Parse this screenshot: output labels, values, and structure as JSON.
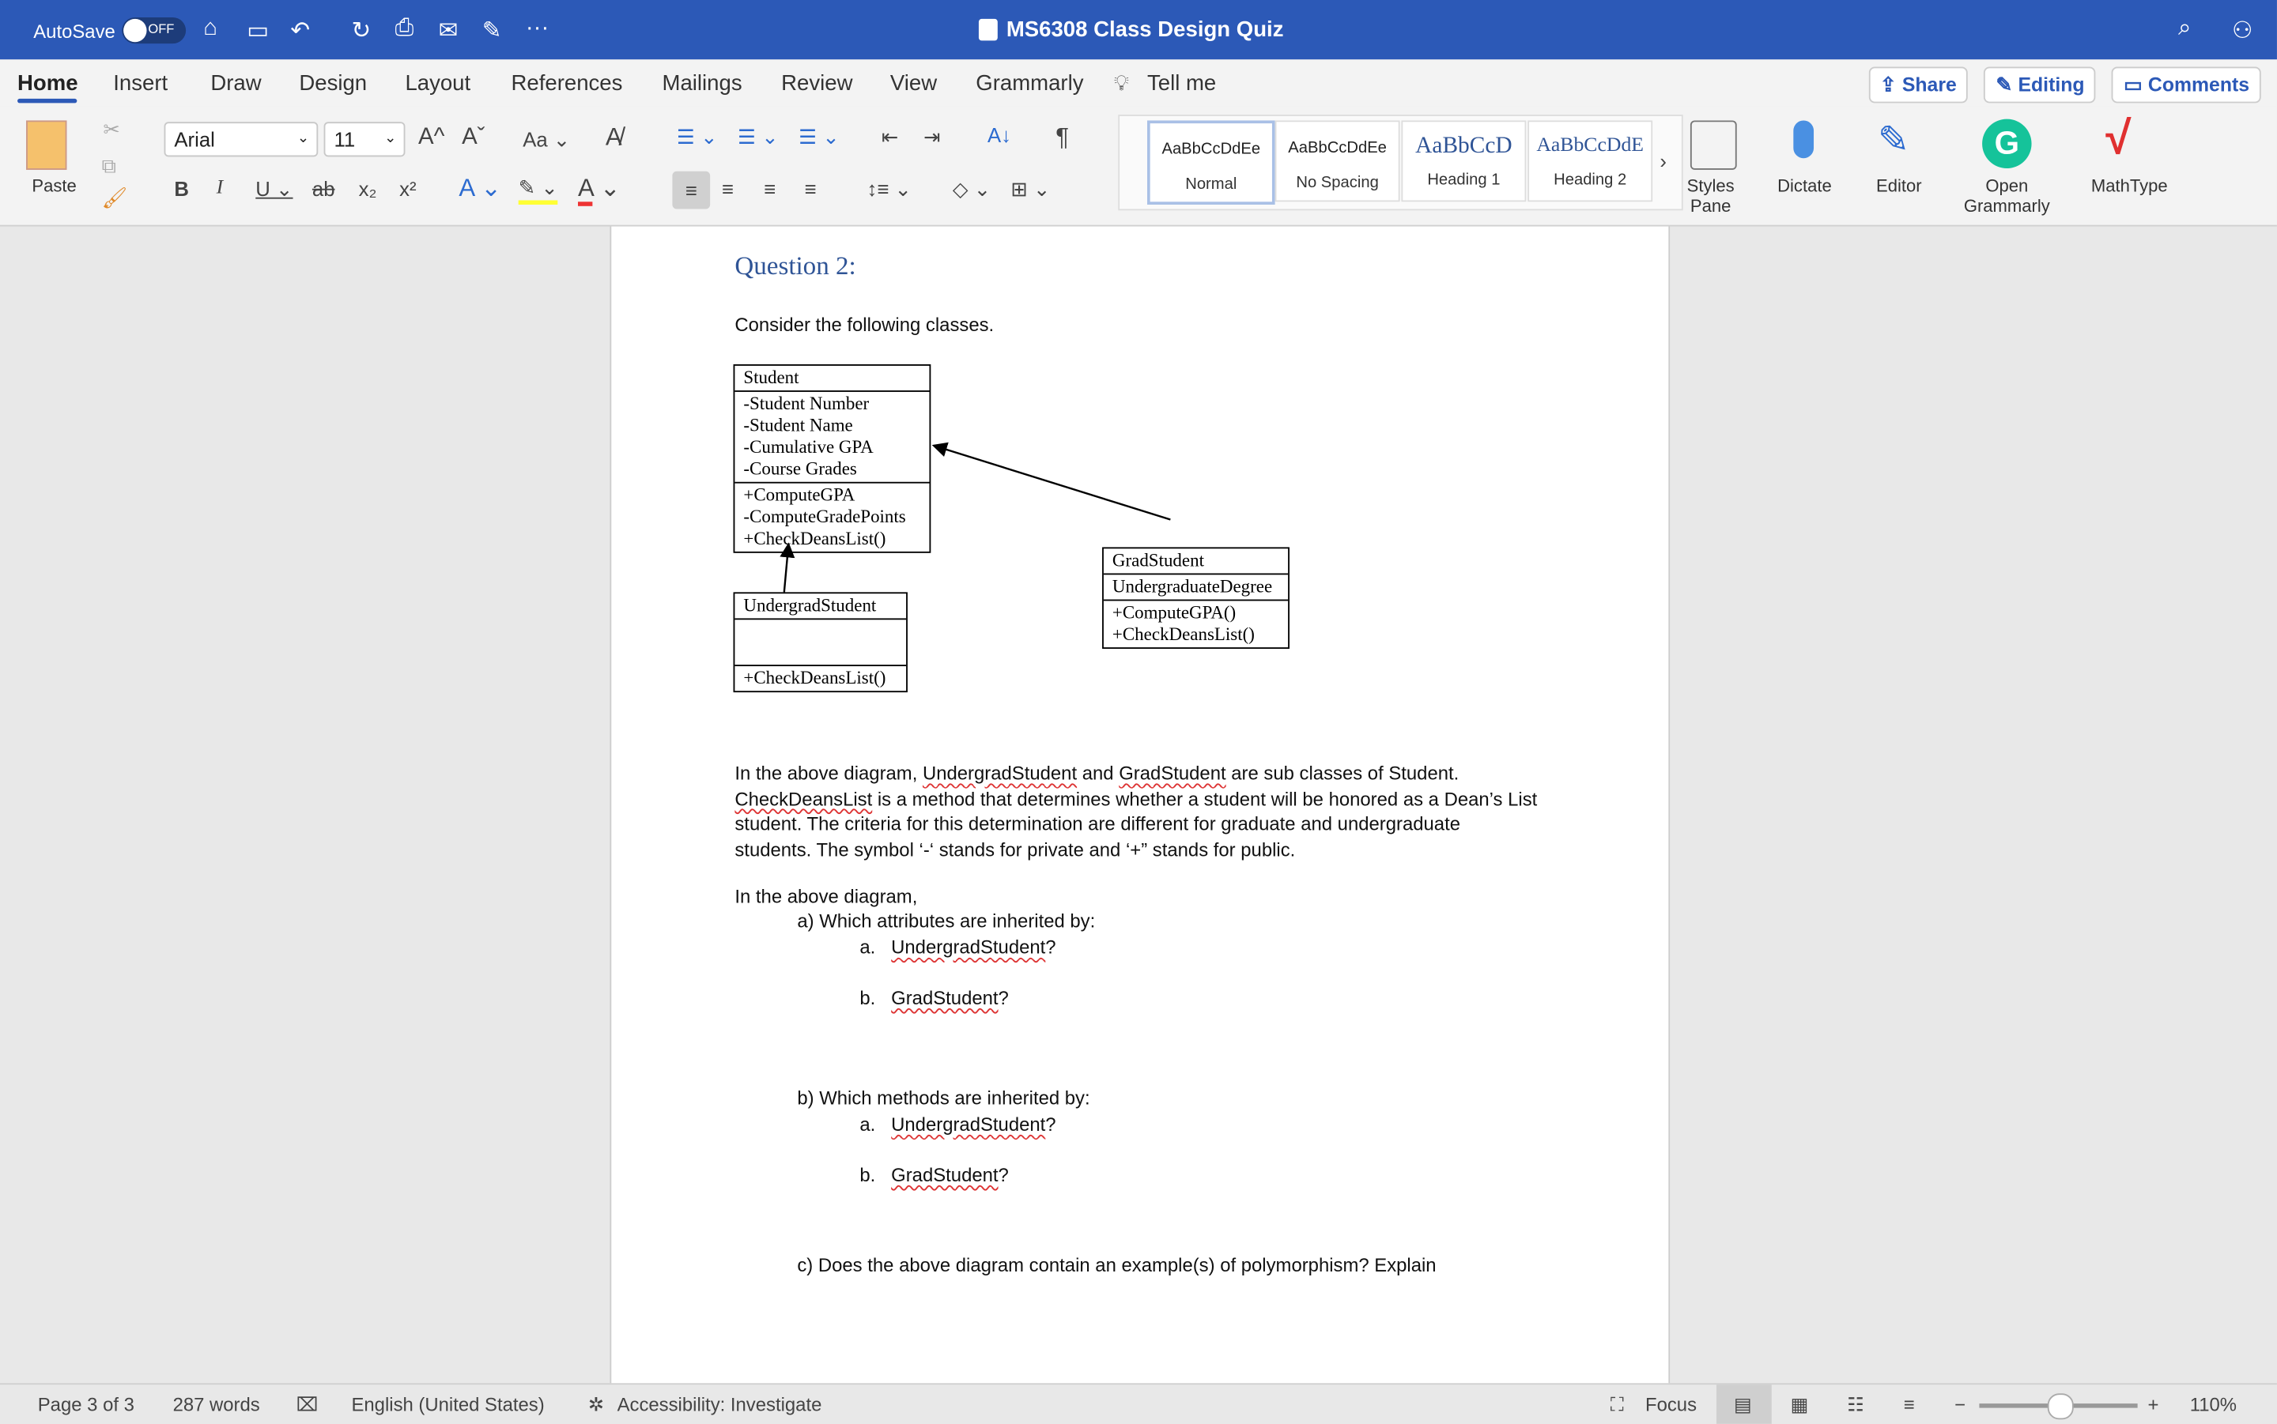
{
  "titlebar": {
    "autosave_label": "AutoSave",
    "autosave_state": "OFF",
    "doc_title": "MS6308 Class Design Quiz",
    "more": "···",
    "title_color": "#2c59b7"
  },
  "tabs": [
    {
      "label": "Home"
    },
    {
      "label": "Insert"
    },
    {
      "label": "Draw"
    },
    {
      "label": "Design"
    },
    {
      "label": "Layout"
    },
    {
      "label": "References"
    },
    {
      "label": "Mailings"
    },
    {
      "label": "Review"
    },
    {
      "label": "View"
    },
    {
      "label": "Grammarly"
    },
    {
      "label": "Tell me"
    }
  ],
  "actions": {
    "share": "Share",
    "editing": "Editing",
    "comments": "Comments"
  },
  "ribbon": {
    "paste": "Paste",
    "font_name": "Arial",
    "font_size": "11",
    "change_case": "Aa",
    "styles": [
      {
        "preview": "AaBbCcDdEe",
        "name": "Normal"
      },
      {
        "preview": "AaBbCcDdEe",
        "name": "No Spacing"
      },
      {
        "preview": "AaBbCcD",
        "name": "Heading 1"
      },
      {
        "preview": "AaBbCcDdE",
        "name": "Heading 2"
      }
    ],
    "styles_pane": "Styles Pane",
    "dictate": "Dictate",
    "editor": "Editor",
    "open_grammarly": "Open Grammarly",
    "mathtype": "MathType"
  },
  "document": {
    "heading": "Question 2:",
    "intro": "Consider the following classes.",
    "uml": {
      "student": {
        "name": "Student",
        "attributes": [
          "-Student Number",
          "-Student Name",
          "-Cumulative GPA",
          "-Course Grades"
        ],
        "methods": [
          "+ComputeGPA",
          "-ComputeGradePoints",
          "+CheckDeansList()"
        ]
      },
      "undergrad": {
        "name": "UndergradStudent",
        "methods": [
          "+CheckDeansList()"
        ]
      },
      "grad": {
        "name": "GradStudent",
        "attributes": [
          "UndergraduateDegree"
        ],
        "methods": [
          "+ComputeGPA()",
          "+CheckDeansList()"
        ]
      }
    },
    "para1_a": "In the above diagram, ",
    "para1_u1": "UndergradStudent",
    "para1_b": " and ",
    "para1_u2": "GradStudent",
    "para1_c": " are sub classes of Student.",
    "para2_u": "CheckDeansList",
    "para2_rest": " is a method that determines whether a student will be honored as a Dean’s List",
    "para3": "student. The criteria for this determination are different for graduate and undergraduate",
    "para4": "students. The symbol ‘-‘ stands for private and ‘+” stands for public.",
    "lead": "In the above diagram,",
    "qa": "a)  Which attributes are inherited by:",
    "qa1_n": "a.",
    "qa1": "UndergradStudent",
    "qa1_q": "?",
    "qa2_n": "b.",
    "qa2": "GradStudent",
    "qa2_q": "?",
    "qb": "b)  Which methods are inherited by:",
    "qb1_n": "a.",
    "qb1": "UndergradStudent",
    "qb1_q": "?",
    "qb2_n": "b.",
    "qb2": "GradStudent",
    "qb2_q": "?",
    "qc": "c) Does the above diagram contain an example(s) of polymorphism? Explain"
  },
  "status": {
    "page": "Page 3 of 3",
    "words": "287 words",
    "language": "English (United States)",
    "accessibility": "Accessibility: Investigate",
    "focus": "Focus",
    "zoom": "110%",
    "zoom_percent": 110
  }
}
